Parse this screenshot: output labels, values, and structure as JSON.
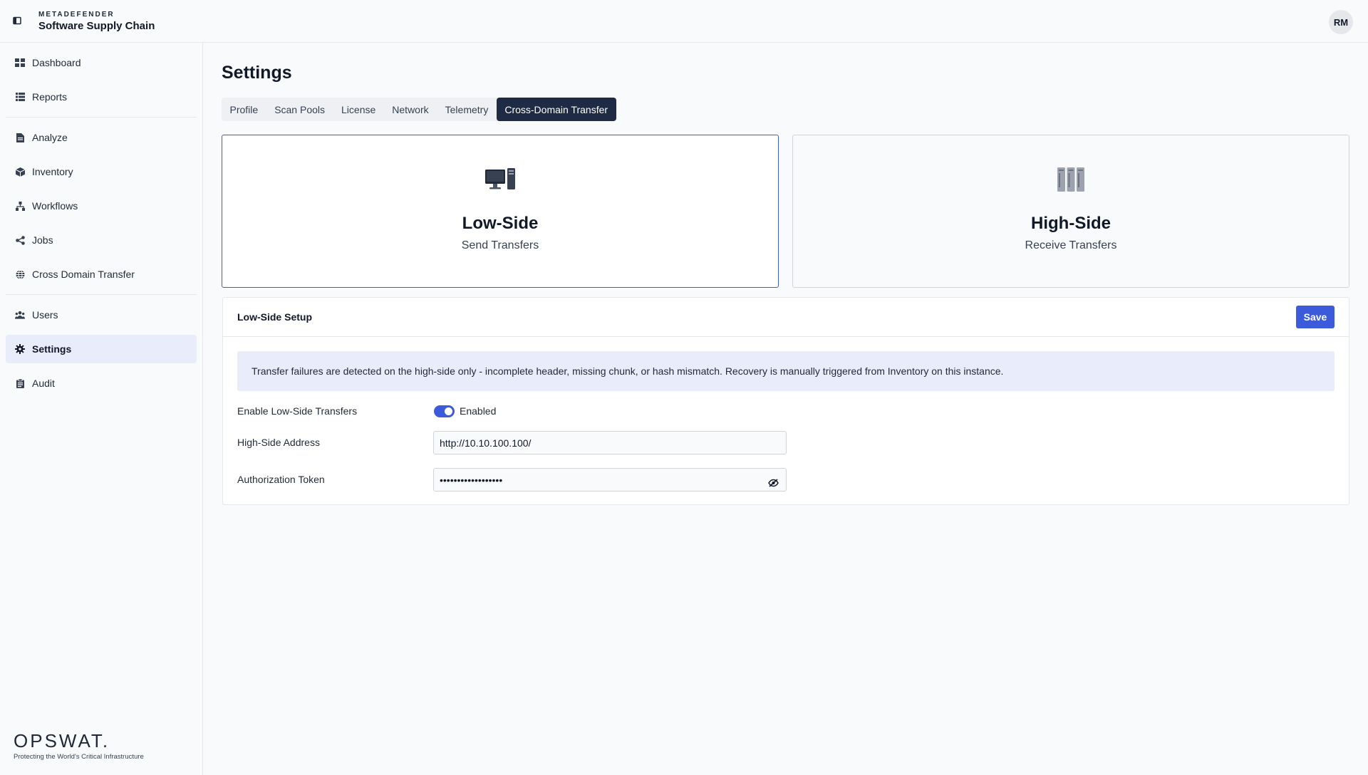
{
  "header": {
    "brand_top": "METADEFENDER",
    "brand_name": "Software Supply Chain",
    "avatar_initials": "RM"
  },
  "sidebar": {
    "items": [
      {
        "label": "Dashboard",
        "icon": "dashboard-icon"
      },
      {
        "label": "Reports",
        "icon": "list-icon"
      },
      {
        "label": "Analyze",
        "icon": "file-icon"
      },
      {
        "label": "Inventory",
        "icon": "box-icon"
      },
      {
        "label": "Workflows",
        "icon": "workflow-icon"
      },
      {
        "label": "Jobs",
        "icon": "share-icon"
      },
      {
        "label": "Cross Domain Transfer",
        "icon": "globe-icon"
      },
      {
        "label": "Users",
        "icon": "users-icon"
      },
      {
        "label": "Settings",
        "icon": "gear-icon",
        "active": true
      },
      {
        "label": "Audit",
        "icon": "clipboard-icon"
      }
    ],
    "footer": {
      "logo": "OPSWAT.",
      "tagline": "Protecting the World's Critical Infrastructure"
    }
  },
  "main": {
    "title": "Settings",
    "tabs": [
      {
        "label": "Profile"
      },
      {
        "label": "Scan Pools"
      },
      {
        "label": "License"
      },
      {
        "label": "Network"
      },
      {
        "label": "Telemetry"
      },
      {
        "label": "Cross-Domain Transfer",
        "active": true
      }
    ],
    "modes": [
      {
        "title": "Low-Side",
        "subtitle": "Send Transfers",
        "icon": "desktop-computer-icon",
        "selected": true
      },
      {
        "title": "High-Side",
        "subtitle": "Receive Transfers",
        "icon": "server-rack-icon",
        "selected": false
      }
    ],
    "setup": {
      "title": "Low-Side Setup",
      "save_label": "Save",
      "info": "Transfer failures are detected on the high-side only - incomplete header, missing chunk, or hash mismatch. Recovery is manually triggered from Inventory on this instance.",
      "enable_label": "Enable Low-Side Transfers",
      "enable_state": "Enabled",
      "enabled": true,
      "address_label": "High-Side Address",
      "address_value": "http://10.10.100.100/",
      "token_label": "Authorization Token",
      "token_value": "••••••••••••••••••"
    }
  },
  "colors": {
    "accent": "#3b5bdb",
    "active_tab": "#1f2a44",
    "info_bg": "#e8ecfb"
  }
}
